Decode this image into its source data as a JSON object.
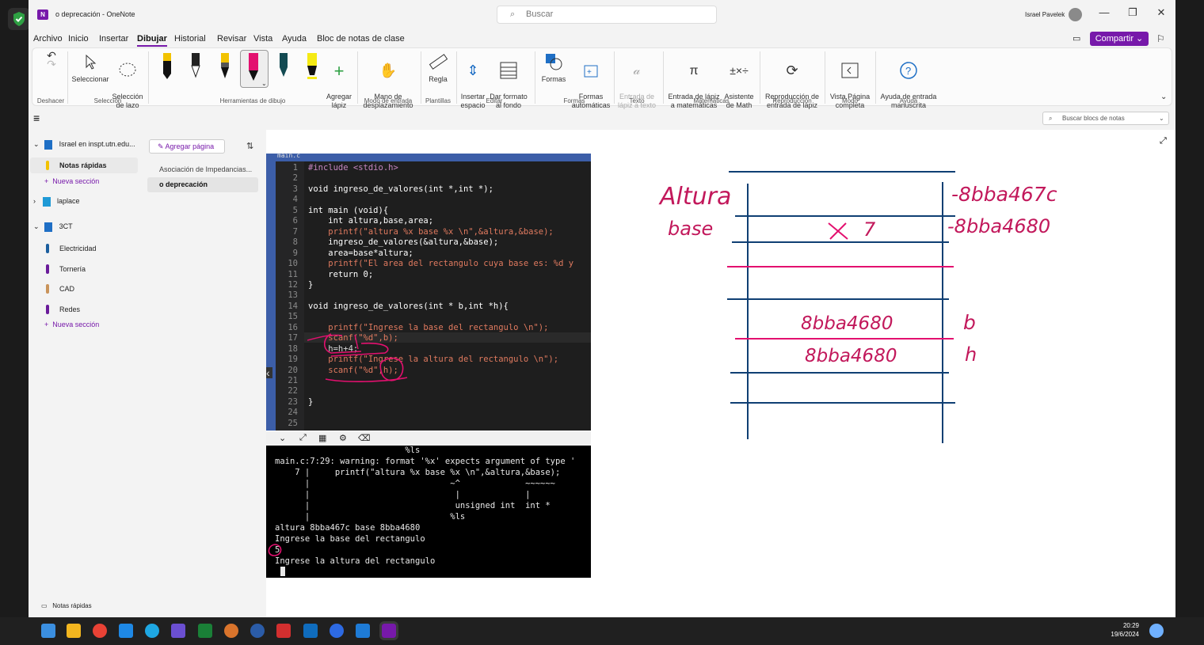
{
  "app": {
    "title": "o deprecación  -  OneNote",
    "search_placeholder": "Buscar",
    "user": "Israel Pavelek",
    "share_label": "Compartir"
  },
  "menu": [
    "Archivo",
    "Inicio",
    "Insertar",
    "Dibujar",
    "Historial",
    "Revisar",
    "Vista",
    "Ayuda",
    "Bloc de notas de clase"
  ],
  "ribbon": {
    "undo_label": "Deshacer",
    "select_label": "Seleccionar",
    "lasso_label": "Selección\nde lazo",
    "add_pen_label": "Agregar\nlápiz",
    "pan_label": "Mano de\ndesplazamiento",
    "ruler_label": "Regla",
    "insert_space_label": "Insertar\nespacio",
    "background_label": "Dar formato\nal fondo",
    "shapes_label": "Formas",
    "autoshapes_label": "Formas\nautomáticas",
    "ink_text_label": "Entrada de\nlápiz a texto",
    "ink_math_label": "Entrada de lápiz\na matemáticas",
    "math_assist_label": "Asistente\nde Math",
    "ink_replay_label": "Reproducción de\nentrada de lápiz",
    "fullpage_label": "Vista Página\ncompleta",
    "ink_help_label": "Ayuda de entrada\nmanuscrita",
    "groups": {
      "undo": "Deshacer",
      "select": "Selección",
      "tools": "Herramientas de dibujo",
      "input": "Modo de entrada",
      "templates": "Plantillas",
      "edit": "Editar",
      "shapes": "Formas",
      "text": "Texto",
      "math": "Matemáticas",
      "replay": "Reproducción",
      "mode": "Modo",
      "help": "Ayuda"
    }
  },
  "notebook_search": "Buscar blocs de notas",
  "nav": {
    "notebook1": "Israel en inspt.utn.edu...",
    "quick_notes": "Notas rápidas",
    "new_section": "Nueva sección",
    "notebook2": "laplace",
    "notebook3": "3CT",
    "sections": [
      "Electricidad",
      "Tornería",
      "CAD",
      "Redes"
    ],
    "new_section2": "Nueva sección",
    "footer": "Notas rápidas"
  },
  "pages": {
    "add_page": "Agregar página",
    "items": [
      "Asociación de Impedancias...",
      "o deprecación"
    ]
  },
  "code": {
    "tab": "main.c",
    "lines": [
      "#include <stdio.h>",
      "",
      "void ingreso_de_valores(int *,int *);",
      "",
      "int main (void){",
      "    int altura,base,area;",
      "    printf(\"altura %x base %x \\n\",&altura,&base);",
      "    ingreso_de_valores(&altura,&base);",
      "    area=base*altura;",
      "    printf(\"El area del rectangulo cuya base es: %d y",
      "    return 0;",
      "}",
      "",
      "void ingreso_de_valores(int * b,int *h){",
      "",
      "    printf(\"Ingrese la base del rectangulo \\n\");",
      "    scanf(\"%d\",b);",
      "    h=h+4;",
      "    printf(\"Ingrese la altura del rectangulo \\n\");",
      "    scanf(\"%d\",h);",
      "",
      "",
      "}",
      "",
      ""
    ]
  },
  "terminal": {
    "lines": [
      "                          %ls",
      "main.c:7:29: warning: format '%x' expects argument of type '",
      "    7 |     printf(\"altura %x base %x \\n\",&altura,&base);",
      "      |                            ~^             ~~~~~~",
      "      |                             |             |",
      "      |                             unsigned int  int *",
      "      |                            %ls",
      "altura 8bba467c base 8bba4680",
      "Ingrese la base del rectangulo",
      "5",
      "Ingrese la altura del rectangulo"
    ]
  },
  "ink": {
    "altura": "Altura",
    "base": "base",
    "val_top": "8bba467c",
    "val_base": "8bba4680",
    "cell_value": "7",
    "mem1": "8bba4680",
    "mem2": "8bba4680",
    "b": "b",
    "h": "h"
  },
  "taskbar": {
    "time": "20:29",
    "date": "19/6/2024"
  }
}
